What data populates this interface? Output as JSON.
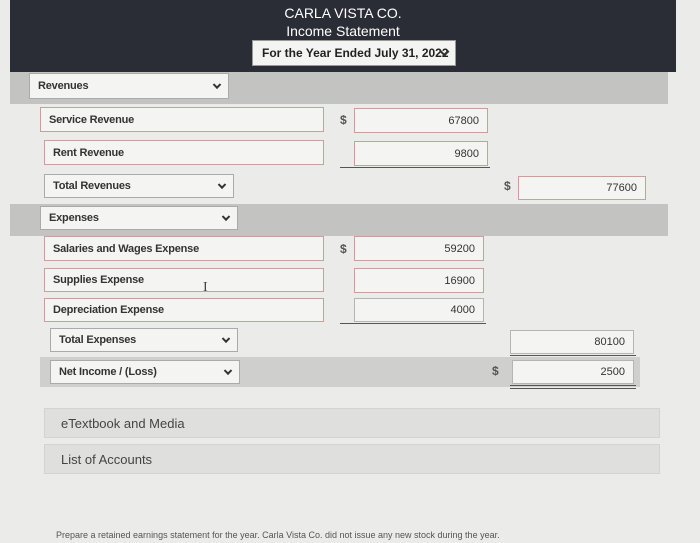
{
  "statement": {
    "company": "CARLA VISTA CO.",
    "name": "Income Statement",
    "period": "For the Year Ended July 31, 2022"
  },
  "revenues": {
    "header": "Revenues",
    "items": [
      {
        "label": "Service Revenue",
        "currency": "$",
        "amount": "67800"
      },
      {
        "label": "Rent Revenue",
        "amount": "9800"
      }
    ],
    "total_label": "Total Revenues",
    "total_currency": "$",
    "total_amount": "77600"
  },
  "expenses": {
    "header": "Expenses",
    "items": [
      {
        "label": "Salaries and Wages Expense",
        "currency": "$",
        "amount": "59200"
      },
      {
        "label": "Supplies Expense",
        "amount": "16900"
      },
      {
        "label": "Depreciation Expense",
        "amount": "4000"
      }
    ],
    "total_label": "Total Expenses",
    "total_amount": "80100"
  },
  "net_income": {
    "label": "Net Income / (Loss)",
    "currency": "$",
    "amount": "2500"
  },
  "links": {
    "etextbook": "eTextbook and Media",
    "accounts": "List of Accounts"
  },
  "footer": "Prepare a retained earnings statement for the year. Carla Vista Co. did not issue any new stock during the year."
}
